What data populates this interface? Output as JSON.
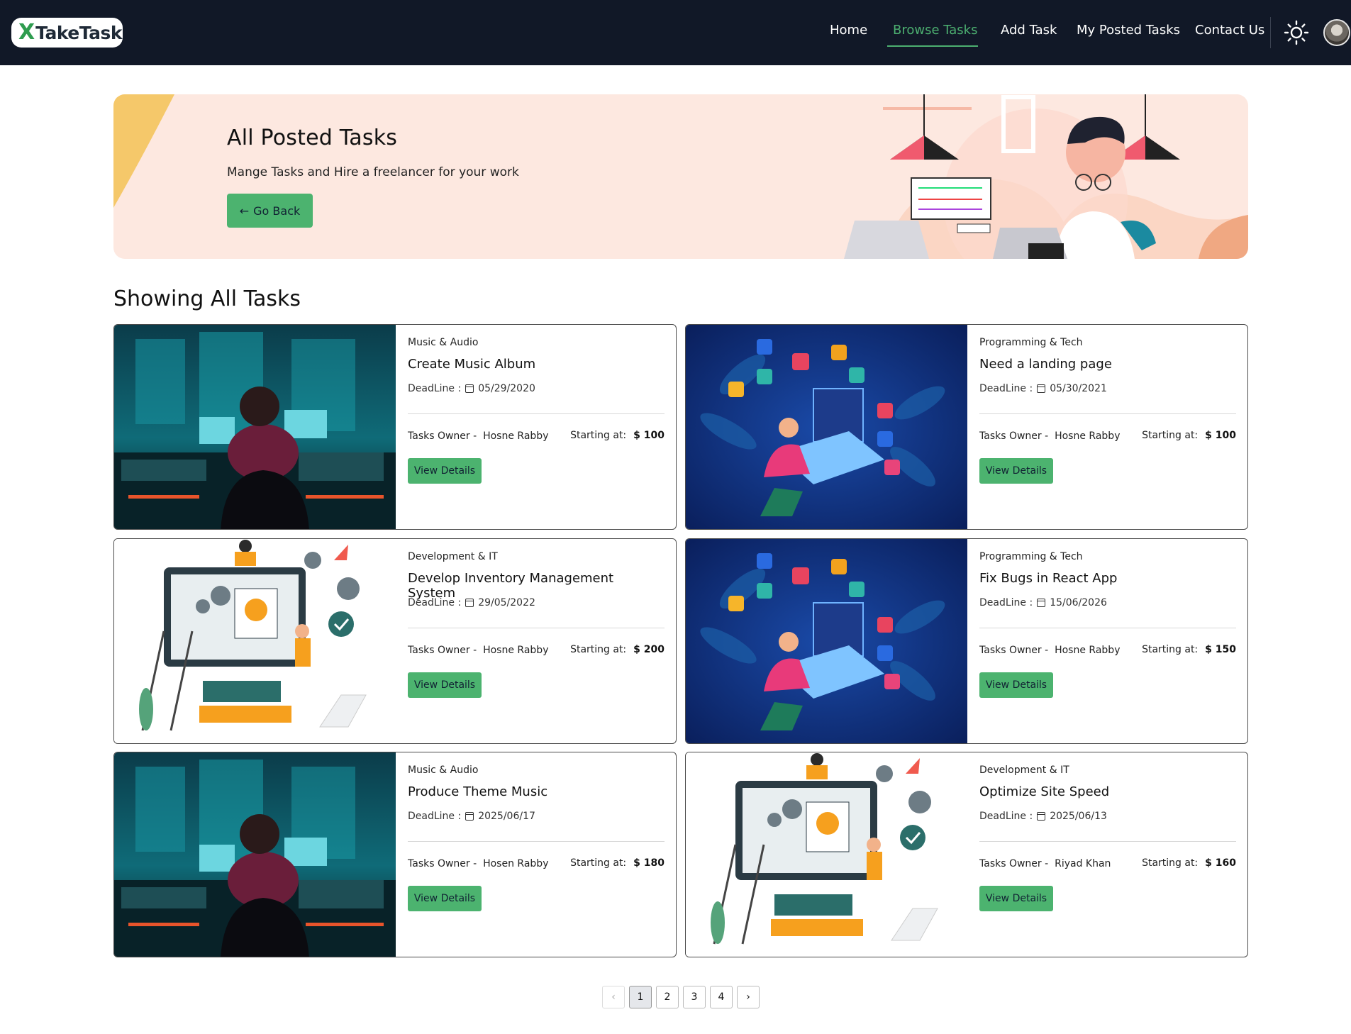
{
  "brand": {
    "logo_mark": "X",
    "logo_text": "TakeTask"
  },
  "nav": {
    "items": [
      {
        "label": "Home",
        "active": false
      },
      {
        "label": "Browse Tasks",
        "active": true
      },
      {
        "label": "Add Task",
        "active": false
      },
      {
        "label": "My Posted Tasks",
        "active": false
      },
      {
        "label": "Contact Us",
        "active": false
      }
    ],
    "theme_toggle_icon": "sun-icon",
    "accent_color": "#4caf70"
  },
  "hero": {
    "title": "All Posted Tasks",
    "subtitle": "Mange Tasks and Hire a freelancer for your work",
    "back_label": "Go Back"
  },
  "section_title": "Showing All Tasks",
  "tasks": [
    {
      "category": "Music & Audio",
      "title": "Create Music Album",
      "deadline_label": "DeadLine :",
      "deadline": "05/29/2020",
      "owner_label": "Tasks Owner -",
      "owner": "Hosne Rabby",
      "starting_label": "Starting at:",
      "price": "$ 100",
      "button": "View Details",
      "image": "music-studio"
    },
    {
      "category": "Programming & Tech",
      "title": "Need a landing page",
      "deadline_label": "DeadLine :",
      "deadline": "05/30/2021",
      "owner_label": "Tasks Owner -",
      "owner": "Hosne Rabby",
      "starting_label": "Starting at:",
      "price": "$ 100",
      "button": "View Details",
      "image": "programmer"
    },
    {
      "category": "Development & IT",
      "title": "Develop Inventory Management System",
      "deadline_label": "DeadLine :",
      "deadline": "29/05/2022",
      "owner_label": "Tasks Owner -",
      "owner": "Hosne Rabby",
      "starting_label": "Starting at:",
      "price": "$ 200",
      "button": "View Details",
      "image": "dev-team"
    },
    {
      "category": "Programming & Tech",
      "title": "Fix Bugs in React App",
      "deadline_label": "DeadLine :",
      "deadline": "15/06/2026",
      "owner_label": "Tasks Owner -",
      "owner": "Hosne Rabby",
      "starting_label": "Starting at:",
      "price": "$ 150",
      "button": "View Details",
      "image": "programmer"
    },
    {
      "category": "Music & Audio",
      "title": "Produce Theme Music",
      "deadline_label": "DeadLine :",
      "deadline": "2025/06/17",
      "owner_label": "Tasks Owner -",
      "owner": "Hosen Rabby",
      "starting_label": "Starting at:",
      "price": "$ 180",
      "button": "View Details",
      "image": "music-studio"
    },
    {
      "category": "Development & IT",
      "title": "Optimize Site Speed",
      "deadline_label": "DeadLine :",
      "deadline": "2025/06/13",
      "owner_label": "Tasks Owner -",
      "owner": "Riyad Khan",
      "starting_label": "Starting at:",
      "price": "$ 160",
      "button": "View Details",
      "image": "dev-team"
    }
  ],
  "pagination": {
    "prev": "‹",
    "pages": [
      "1",
      "2",
      "3",
      "4"
    ],
    "current": "1",
    "next": "›"
  }
}
